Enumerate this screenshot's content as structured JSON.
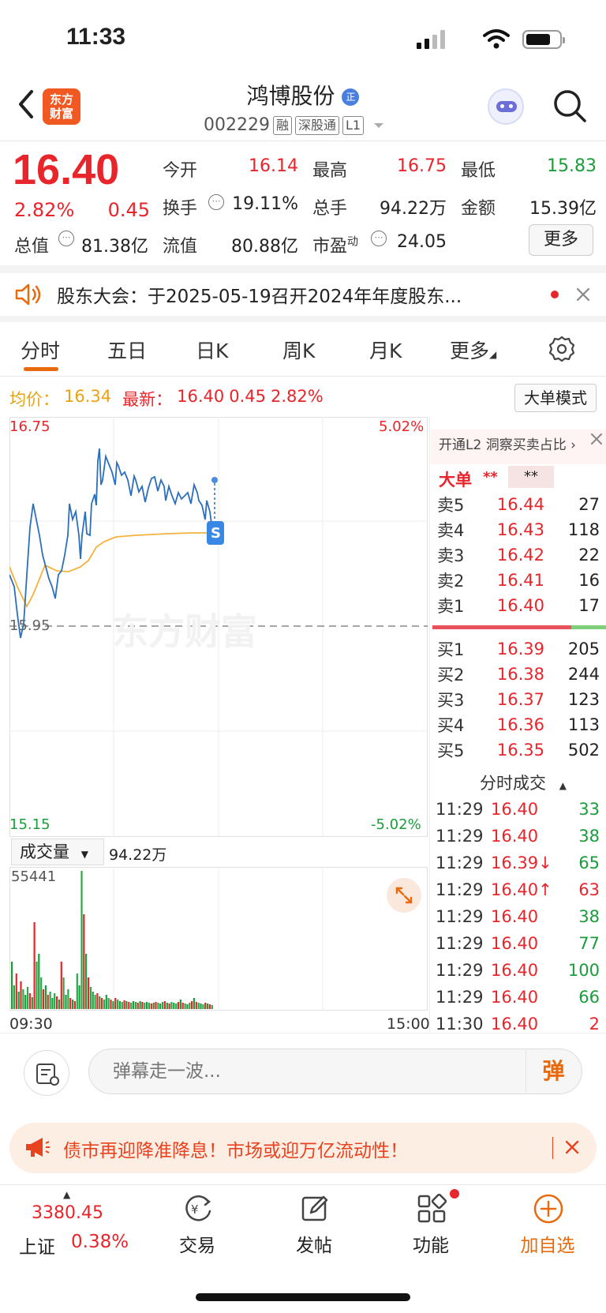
{
  "status_bar": {
    "time": "11:33"
  },
  "header": {
    "logo_line1": "东方",
    "logo_line2": "财富",
    "stock_name": "鸿博股份",
    "name_badge": "正",
    "code": "002229",
    "tags": [
      "融",
      "深股通",
      "L1"
    ]
  },
  "quote": {
    "price": "16.40",
    "change_pct": "2.82%",
    "change_amt": "0.45",
    "open_label": "今开",
    "open": "16.14",
    "high_label": "最高",
    "high": "16.75",
    "low_label": "最低",
    "low": "15.83",
    "turnover_label": "换手",
    "turnover": "19.11%",
    "total_hands_label": "总手",
    "total_hands": "94.22万",
    "amount_label": "金额",
    "amount": "15.39亿",
    "mkt_cap_label": "总值",
    "mkt_cap": "81.38亿",
    "float_cap_label": "流值",
    "float_cap": "80.88亿",
    "pe_label": "市盈",
    "pe_sup": "动",
    "pe": "24.05",
    "more_label": "更多"
  },
  "notice": {
    "text": "股东大会：于2025-05-19召开2024年年度股东..."
  },
  "tabs": [
    "分时",
    "五日",
    "日K",
    "周K",
    "月K",
    "更多"
  ],
  "info_line": {
    "avg_label": "均价：",
    "avg": "16.34",
    "latest_label": "最新：",
    "latest": "16.40",
    "chg": "0.45",
    "pct": "2.82%",
    "big_order_mode": "大单模式"
  },
  "chart_labels": {
    "y_top": "16.75",
    "y_mid": "15.95",
    "y_bottom": "15.15",
    "pct_top": "5.02%",
    "pct_bottom": "-5.02%",
    "watermark": "东方财富",
    "vol_selector": "成交量",
    "vol_total": "94.22万",
    "vol_max": "55441",
    "time_start": "09:30",
    "time_end": "15:00"
  },
  "order_book": {
    "l2_promo": "开通L2 洞察买卖占比",
    "big_order_label": "大单",
    "big_order_val1": "**",
    "big_order_val2": "**",
    "asks": [
      {
        "label": "卖5",
        "price": "16.44",
        "vol": "27"
      },
      {
        "label": "卖4",
        "price": "16.43",
        "vol": "118"
      },
      {
        "label": "卖3",
        "price": "16.42",
        "vol": "22"
      },
      {
        "label": "卖2",
        "price": "16.41",
        "vol": "16"
      },
      {
        "label": "卖1",
        "price": "16.40",
        "vol": "17"
      }
    ],
    "bids": [
      {
        "label": "买1",
        "price": "16.39",
        "vol": "205"
      },
      {
        "label": "买2",
        "price": "16.38",
        "vol": "244"
      },
      {
        "label": "买3",
        "price": "16.37",
        "vol": "123"
      },
      {
        "label": "买4",
        "price": "16.36",
        "vol": "113"
      },
      {
        "label": "买5",
        "price": "16.35",
        "vol": "502"
      }
    ],
    "ticks_title": "分时成交",
    "ticks": [
      {
        "time": "11:29",
        "price": "16.40",
        "vol": "33",
        "dir": "sell"
      },
      {
        "time": "11:29",
        "price": "16.40",
        "vol": "38",
        "dir": "sell"
      },
      {
        "time": "11:29",
        "price": "16.39↓",
        "vol": "65",
        "dir": "sell"
      },
      {
        "time": "11:29",
        "price": "16.40↑",
        "vol": "63",
        "dir": "buy"
      },
      {
        "time": "11:29",
        "price": "16.40",
        "vol": "38",
        "dir": "sell"
      },
      {
        "time": "11:29",
        "price": "16.40",
        "vol": "77",
        "dir": "sell"
      },
      {
        "time": "11:29",
        "price": "16.40",
        "vol": "100",
        "dir": "sell"
      },
      {
        "time": "11:29",
        "price": "16.40",
        "vol": "66",
        "dir": "sell"
      },
      {
        "time": "11:30",
        "price": "16.40",
        "vol": "2",
        "dir": "buy"
      }
    ]
  },
  "danmu": {
    "placeholder": "弹幕走一波...",
    "button": "弹"
  },
  "banner": {
    "text": "债市再迎降准降息！市场或迎万亿流动性！"
  },
  "bottom_nav": {
    "index_value": "3380.45",
    "index_name": "上证",
    "index_pct": "0.38%",
    "trade": "交易",
    "post": "发帖",
    "function": "功能",
    "add_watch": "加自选"
  },
  "colors": {
    "up": "#e8252b",
    "down": "#1a9d3a",
    "brand": "#e86a0c",
    "avg_line": "#f5a623",
    "price_line": "#2c6fbd"
  }
}
